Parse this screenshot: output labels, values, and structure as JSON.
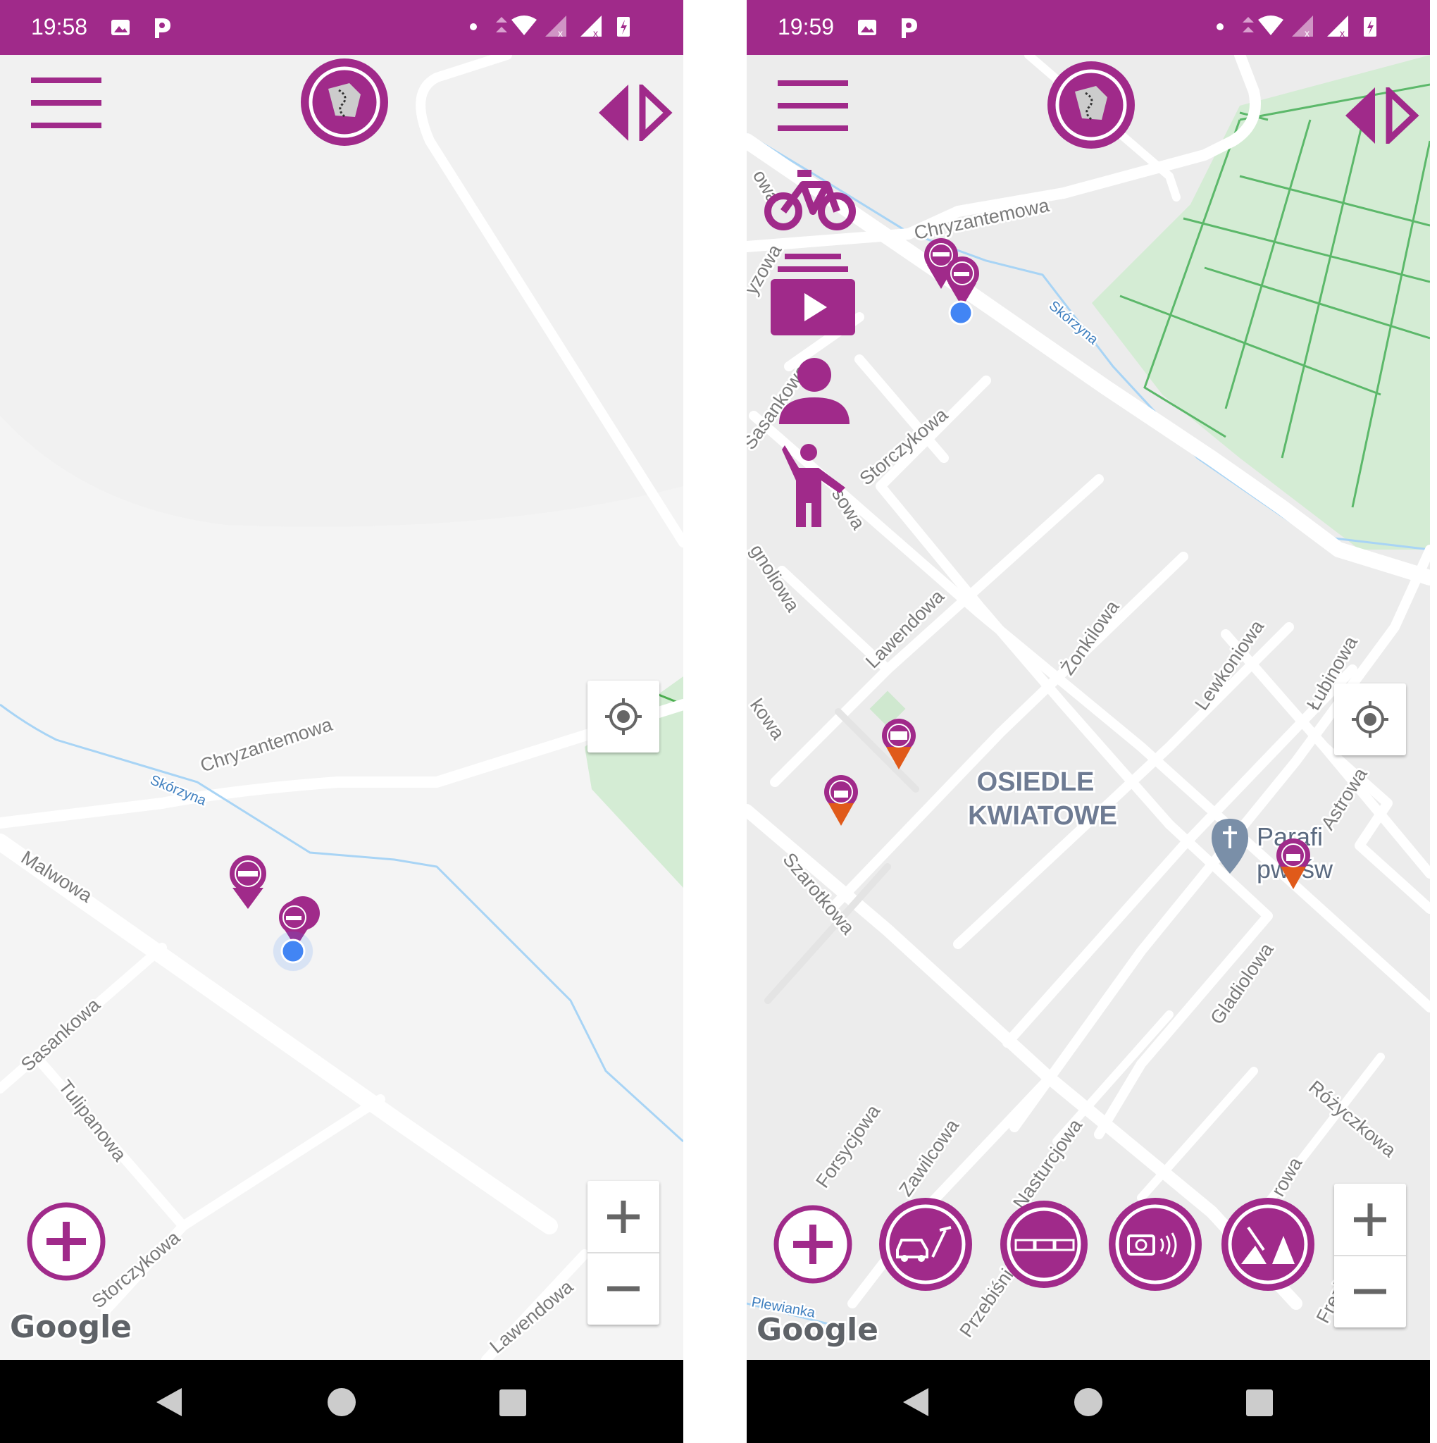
{
  "colors": {
    "brand": "#a02a8a",
    "road": "#ffffff",
    "land": "#f2f2f2",
    "park": "#d4ecd4",
    "water": "#a8d4f5",
    "marker_orange": "#e05a1a",
    "user_location": "#4285f4"
  },
  "left": {
    "status": {
      "time": "19:58"
    },
    "streets": {
      "chryzantemowa": "Chryzantemowa",
      "skorzyna": "Skórzyna",
      "malwowa": "Malwowa",
      "sasankowa": "Sasankowa",
      "tulipanowa": "Tulipanowa",
      "storczykowa": "Storczykowa",
      "lawendowa": "Lawendowa"
    },
    "google": "Google"
  },
  "right": {
    "status": {
      "time": "19:59"
    },
    "streets": {
      "chryzantemowa": "Chryzantemowa",
      "skorzyna": "Skórzyna",
      "owa": "owa",
      "yzowa": "yzowa",
      "sasankowa": "Sasankowa",
      "storczykowa": "Storczykowa",
      "sowa": "sowa",
      "gnoliowa": "gnoliowa",
      "lawendowa": "Lawendowa",
      "zonkilowa": "Żonkilowa",
      "lewkoniowa": "Lewkoniowa",
      "lubinowa": "Łubinowa",
      "kowa": "kowa",
      "astrowa": "Astrowa",
      "szarotkowa": "Szarotkowa",
      "gladiolowa": "Gladiolowa",
      "forsycjowa": "Forsycjowa",
      "zawilcowa": "Zawilcowa",
      "nasturcjowa": "Nasturcjowa",
      "przebisniegowa": "Przebiśniegowa",
      "rozyczkowa": "Różyczkowa",
      "rowa": "rowa",
      "frezjowa": "Frezjowa",
      "plewianka": "Plewianka"
    },
    "district_line1": "OSIEDLE",
    "district_line2": "KWIATOWE",
    "poi_line1": "Parafi",
    "poi_line2": "pw. św",
    "google": "Google",
    "side_menu": [
      "bicycle-icon",
      "video-list-icon",
      "person-icon",
      "hitchhiker-icon"
    ],
    "report_buttons": [
      "add-icon",
      "accident-icon",
      "traffic-jam-icon",
      "speed-camera-icon",
      "road-works-icon"
    ]
  }
}
